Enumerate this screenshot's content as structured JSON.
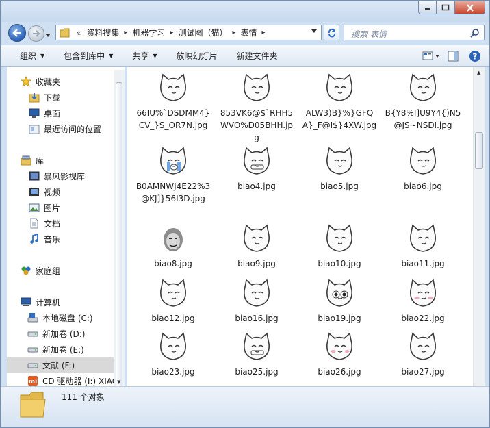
{
  "address": {
    "overflow": "«",
    "crumbs": [
      "资料搜集",
      "机器学习",
      "测试图（猫）",
      "表情"
    ]
  },
  "search": {
    "placeholder": "搜索 表情"
  },
  "toolbar": {
    "organize": "组织",
    "include_in_library": "包含到库中",
    "share": "共享",
    "slideshow": "放映幻灯片",
    "new_folder": "新建文件夹"
  },
  "nav": {
    "favorites": "收藏夹",
    "downloads": "下载",
    "desktop": "桌面",
    "recent": "最近访问的位置",
    "libraries": "库",
    "storm": "暴风影视库",
    "videos": "视频",
    "pictures": "图片",
    "documents": "文档",
    "music": "音乐",
    "homegroup": "家庭组",
    "computer": "计算机",
    "disk_c": "本地磁盘 (C:)",
    "disk_d": "新加卷 (D:)",
    "disk_e": "新加卷 (E:)",
    "disk_f": "文献 (F:)",
    "drive_i": "CD 驱动器 (I:) XIAO"
  },
  "files": [
    {
      "name": "66IU%`DSDMM4}CV_}S_OR7N.jpg",
      "icon": "cat-tears-icon"
    },
    {
      "name": "853VK6@$`RHH5WVO%D05BHH.jpg",
      "icon": "cat-annoyed-icon"
    },
    {
      "name": "ALW3)B}%}GFQA}_F@I$}4XW.jpg",
      "icon": "cat-smug-icon"
    },
    {
      "name": "B{Y8%I]U9Y4{)N5@JS~NSDI.jpg",
      "icon": "cat-sleepy-icon"
    },
    {
      "name": "B0AMNWJ4E22%3@KJ]}56I3D.jpg",
      "icon": "cat-crying-icon"
    },
    {
      "name": "biao4.jpg",
      "icon": "cat-grin-icon"
    },
    {
      "name": "biao5.jpg",
      "icon": "cat-laugh-icon"
    },
    {
      "name": "biao6.jpg",
      "icon": "cat-happy-icon"
    },
    {
      "name": "biao8.jpg",
      "icon": "face-photo-icon"
    },
    {
      "name": "biao9.jpg",
      "icon": "cat-sidelook-icon"
    },
    {
      "name": "biao10.jpg",
      "icon": "cat-angry-icon"
    },
    {
      "name": "biao11.jpg",
      "icon": "cat-shocked-icon"
    },
    {
      "name": "biao12.jpg",
      "icon": "cat-gloomy-icon"
    },
    {
      "name": "biao16.jpg",
      "icon": "cat-unimpressed-icon"
    },
    {
      "name": "biao19.jpg",
      "icon": "cat-bigeyes-icon"
    },
    {
      "name": "biao22.jpg",
      "icon": "cat-blush-icon"
    },
    {
      "name": "biao23.jpg",
      "icon": "cat-bruised-icon"
    },
    {
      "name": "biao25.jpg",
      "icon": "cat-teeth-icon"
    },
    {
      "name": "biao26.jpg",
      "icon": "cat-cute-icon"
    },
    {
      "name": "biao27.jpg",
      "icon": "cat-buckteeth-icon"
    }
  ],
  "status": {
    "count": "111 个对象"
  },
  "colors": {
    "accent": "#2a62b8",
    "selection": "#d9d9d9",
    "close": "#c8452c"
  }
}
